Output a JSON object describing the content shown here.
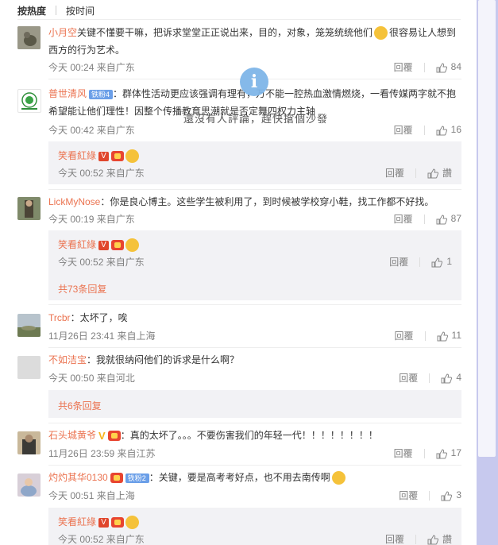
{
  "tabs": {
    "hot": "按热度",
    "time": "按时间"
  },
  "comments": [
    {
      "name": "小月空",
      "text": "关键不懂要干嘛，把诉求堂堂正正说出来，目的，对象，笼笼统统他们",
      "text2": "很容易让人想到西方的行为艺术。",
      "time": "今天 00:24 来自广东",
      "reply": "回覆",
      "likes": "84"
    },
    {
      "name": "普世清风",
      "level": "铁粉4",
      "text": "：群体性活动更应该强调有理有",
      "text_after": "，万不能一腔热血激情燃烧，一看传媒两字就不抱希望能让他们理性！因整个传播教育思潮就是否定舞四权力主轴",
      "time": "今天 00:42 来自广东",
      "reply": "回覆",
      "likes": "16"
    },
    {
      "name": "LickMyNose",
      "text": "：你是良心博主。这些学生被利用了，到时候被学校穿小鞋，找工作都不好找。",
      "time": "今天 00:19 来自广东",
      "reply": "回覆",
      "likes": "87"
    },
    {
      "name": "Trcbr",
      "text": "：太坏了，唉",
      "time": "11月26日 23:41 来自上海",
      "reply": "回覆",
      "likes": "11"
    },
    {
      "name": "不如洁宝",
      "text": "：我就很纳闷他们的诉求是什么啊？",
      "time": "今天 00:50 来自河北",
      "reply": "回覆",
      "likes": "4"
    },
    {
      "name": "石头城黄爷",
      "text": "：真的太坏了。。。不要伤害我们的年轻一代！！！！！！！！",
      "time": "11月26日 23:59 来自江苏",
      "reply": "回覆",
      "likes": "17"
    },
    {
      "name": "灼灼其华0130",
      "level": "铁粉2",
      "text": "：关键，要是高考考好点，也不用去南传啊",
      "time": "今天 00:51 来自上海",
      "reply": "回覆",
      "likes": "3"
    }
  ],
  "replies": [
    {
      "name": "笑看紅綠",
      "time": "今天 00:52 来自广东",
      "reply": "回覆",
      "likes": "讚"
    },
    {
      "name": "笑看紅綠",
      "time": "今天 00:52 来自广东",
      "reply": "回覆",
      "likes": "1",
      "more": "共73条回复"
    },
    {
      "more": "共6条回复"
    },
    {
      "name": "笑看紅綠",
      "time": "今天 00:52 来自广东",
      "reply": "回覆",
      "likes": "讚"
    }
  ],
  "overlay": {
    "icon": "i",
    "text": "還沒有人評論，趕快搶個沙發"
  },
  "colors": {
    "name": "#eb7350",
    "meta": "#808080",
    "reply_bg": "#f2f2f5",
    "scrollbar": "#c7c9ee"
  }
}
